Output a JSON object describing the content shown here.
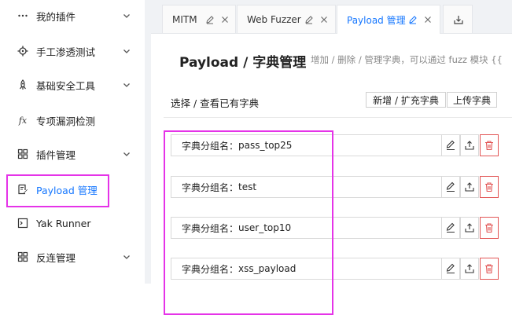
{
  "sidebar": {
    "items": [
      {
        "label": "我的插件",
        "icon": "more-dots-icon",
        "chevron": true
      },
      {
        "label": "手工渗透测试",
        "icon": "target-crosshair-icon",
        "chevron": true
      },
      {
        "label": "基础安全工具",
        "icon": "rocket-icon",
        "chevron": true
      },
      {
        "label": "专项漏洞检测",
        "icon": "fx-icon",
        "chevron": false
      },
      {
        "label": "插件管理",
        "icon": "grid-icon",
        "chevron": true
      },
      {
        "label": "Payload 管理",
        "icon": "document-edit-icon",
        "chevron": false
      },
      {
        "label": "Yak Runner",
        "icon": "terminal-icon",
        "chevron": false
      },
      {
        "label": "反连管理",
        "icon": "grid-icon",
        "chevron": true
      }
    ],
    "active_index": 5
  },
  "tabs": [
    {
      "label": "MITM",
      "active": false
    },
    {
      "label": "Web Fuzzer",
      "active": false
    },
    {
      "label": "Payload 管理",
      "active": true
    }
  ],
  "tab_extra_icon": "download-icon",
  "page": {
    "title": "Payload / 字典管理",
    "description": "增加 / 删除 / 管理字典，可以通过 fuzz 模块 {{"
  },
  "section": {
    "label": "选择 / 查看已有字典",
    "add_button": "新增 / 扩充字典",
    "upload_button": "上传字典"
  },
  "groups": [
    {
      "prefix": "字典分组名：",
      "name": "pass_top25"
    },
    {
      "prefix": "字典分组名：",
      "name": "test"
    },
    {
      "prefix": "字典分组名：",
      "name": "user_top10"
    },
    {
      "prefix": "字典分组名：",
      "name": "xss_payload"
    }
  ],
  "colors": {
    "accent": "#1677ff",
    "highlight": "#e533e8",
    "danger": "#e25555"
  }
}
